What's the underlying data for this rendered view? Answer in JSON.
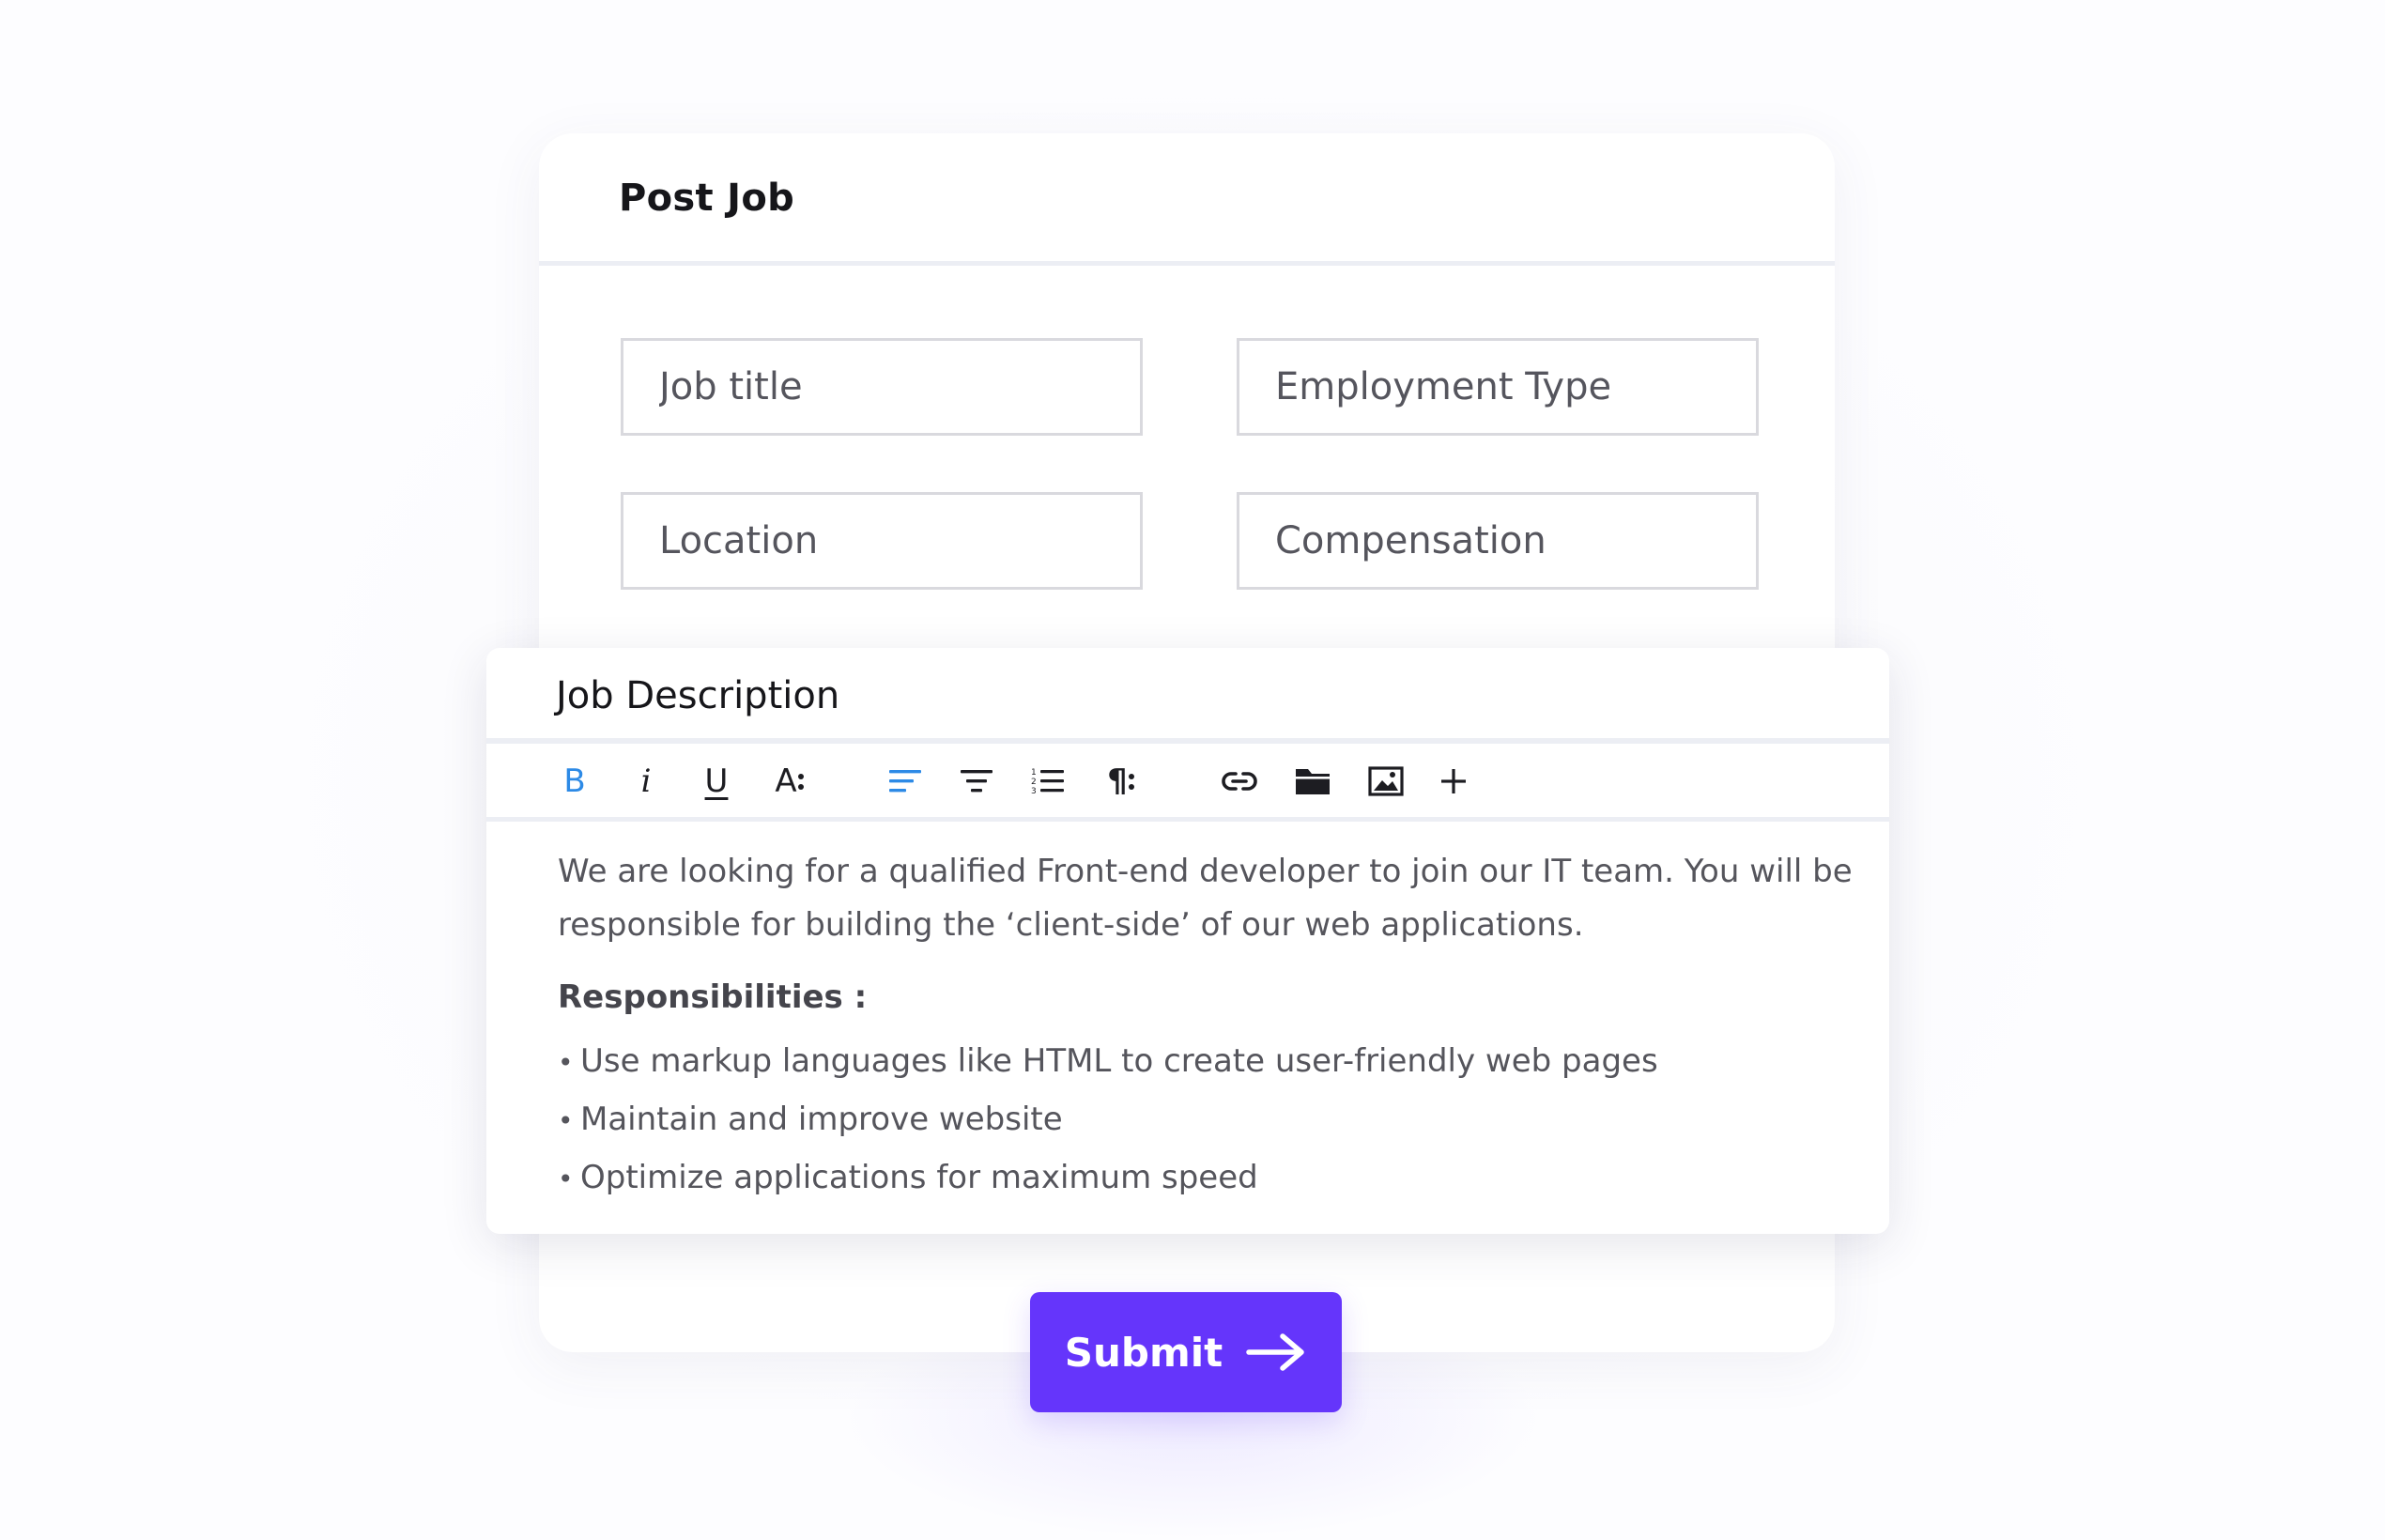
{
  "colors": {
    "accent": "#6535fb",
    "toolbar_active": "#2d8ae6",
    "border": "#d9d9de",
    "divider": "#eceef4"
  },
  "post_job": {
    "title": "Post Job",
    "fields": {
      "job_title": {
        "placeholder": "Job title"
      },
      "employment_type": {
        "placeholder": "Employment Type"
      },
      "location": {
        "placeholder": "Location"
      },
      "compensation": {
        "placeholder": "Compensation"
      }
    }
  },
  "job_description": {
    "title": "Job Description",
    "toolbar": {
      "bold": {
        "label": "B",
        "icon": "bold-icon"
      },
      "italic": {
        "label": "i",
        "icon": "italic-icon"
      },
      "underline": {
        "label": "U",
        "icon": "underline-icon"
      },
      "font_size": {
        "label": "A",
        "icon": "font-size-icon"
      },
      "align_left": {
        "icon": "align-left-icon"
      },
      "align_center": {
        "icon": "align-center-icon"
      },
      "ordered_list": {
        "icon": "ordered-list-icon"
      },
      "paragraph": {
        "label": "¶",
        "icon": "paragraph-icon"
      },
      "link": {
        "icon": "link-icon"
      },
      "folder": {
        "icon": "folder-icon"
      },
      "image": {
        "icon": "image-icon"
      },
      "more": {
        "label": "+",
        "icon": "plus-icon"
      }
    },
    "body": {
      "intro": "We are looking for a qualified Front-end developer to join our IT team. You will be responsible for building the ‘client-side’ of our web applications.",
      "responsibilities_heading": "Responsibilities :",
      "bullet_symbol": "•",
      "bullets": [
        "Use markup languages like HTML to create user-friendly web pages",
        "Maintain and improve website",
        "Optimize applications for maximum speed"
      ]
    }
  },
  "submit": {
    "label": "Submit",
    "icon": "arrow-right-icon"
  }
}
